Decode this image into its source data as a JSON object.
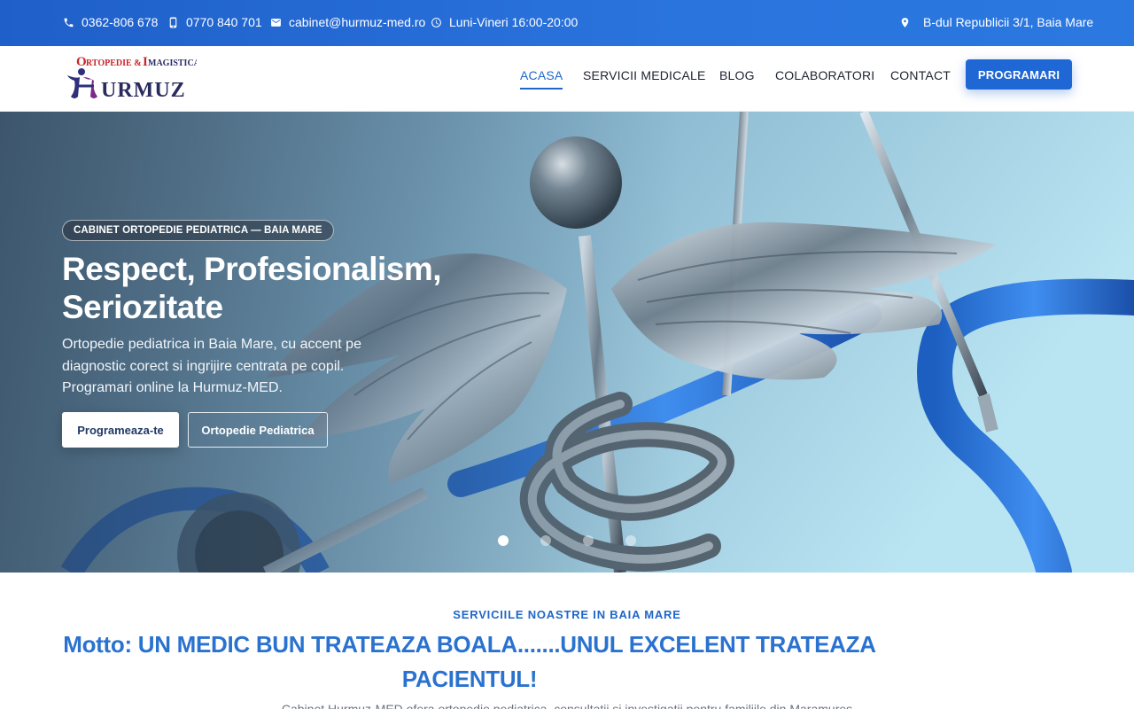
{
  "topbar": {
    "phone1": "0362-806 678",
    "phone2": "0770 840 701",
    "email": "cabinet@hurmuz-med.ro",
    "hours": "Luni-Vineri 16:00-20:00",
    "address": "B-dul Republicii 3/1, Baia Mare",
    "icons": [
      "phone-icon",
      "mobile-icon",
      "mail-icon",
      "clock-icon",
      "map-pin-icon"
    ]
  },
  "logo": {
    "line1": "Ortopedie & Imagistica",
    "line2": "HURMUZ"
  },
  "nav": {
    "items": [
      "ACASA",
      "SERVICII MEDICALE",
      "BLOG",
      "COLABORATORI",
      "CONTACT"
    ],
    "active": "ACASA",
    "cta": "PROGRAMARI"
  },
  "hero": {
    "badge": "CABINET ORTOPEDIE PEDIATRICA — BAIA MARE",
    "title": "Respect, Profesionalism, Seriozitate",
    "text": "Ortopedie pediatrica in Baia Mare, cu accent pe diagnostic corect si ingrijire centrata pe copil. Programari online la Hurmuz-MED.",
    "primary_button": "Programeaza-te",
    "secondary_button": "Ortopedie Pediatrica",
    "slide_count": 4,
    "active_slide": 1
  },
  "services": {
    "eyebrow": "SERVICIILE NOASTRE IN BAIA MARE",
    "motto": "Motto: UN MEDIC BUN TRATEAZA BOALA.......UNUL EXCELENT TRATEAZA PACIENTUL!",
    "intro": "Cabinet Hurmuz-MED ofera ortopedie pediatrica, consultatii si investigatii pentru familiile din Maramures"
  },
  "colors": {
    "brand_blue": "#1f67d4",
    "topbar_blue": "#2a74de",
    "heading_blue": "#2a72d0",
    "nav_text": "#1d2230"
  }
}
